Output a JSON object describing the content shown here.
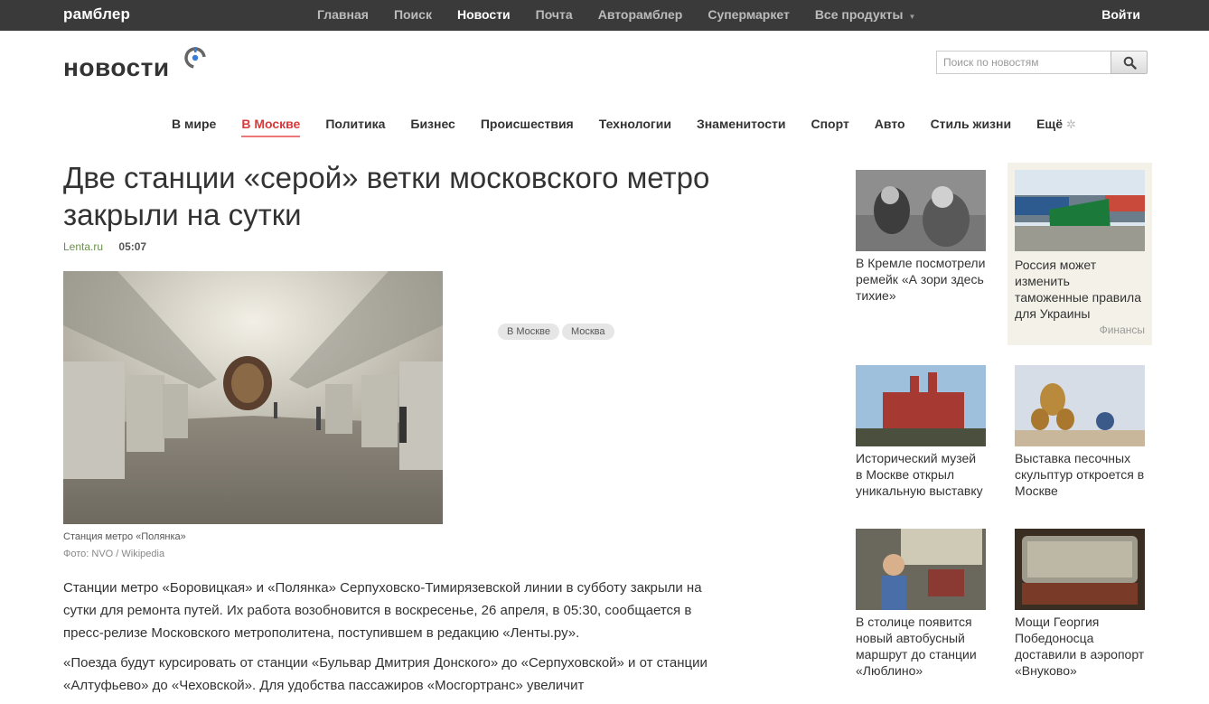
{
  "topbar": {
    "brand": "рамблер",
    "nav": [
      "Главная",
      "Поиск",
      "Новости",
      "Почта",
      "Авторамблер",
      "Супермаркет",
      "Все продукты"
    ],
    "active": "Новости",
    "login": "Войти"
  },
  "logo": {
    "text": "новости"
  },
  "search": {
    "placeholder": "Поиск по новостям"
  },
  "categories": {
    "items": [
      "В мире",
      "В Москве",
      "Политика",
      "Бизнес",
      "Происшествия",
      "Технологии",
      "Знаменитости",
      "Спорт",
      "Авто",
      "Стиль жизни",
      "Ещё"
    ],
    "active": "В Москве"
  },
  "article": {
    "title": "Две станции «серой» ветки московского метро закрыли на сутки",
    "source": "Lenta.ru",
    "time": "05:07",
    "photo_caption": "Станция метро «Полянка»",
    "photo_credit": "Фото: NVO / Wikipedia",
    "tags": [
      "В Москве",
      "Москва"
    ],
    "paragraphs": [
      "Станции метро «Боровицкая» и «Полянка» Серпуховско-Тимирязевской линии в субботу закрыли на сутки для ремонта путей. Их работа возобновится в воскресенье, 26 апреля, в 05:30, сообщается в пресс-релизе Московского метрополитена, поступившем в редакцию «Ленты.ру».",
      "«Поезда будут курсировать от станции «Бульвар Дмитрия Донского» до «Серпуховской» и от станции «Алтуфьево» до «Чеховской». Для удобства пассажиров «Мосгортранс» увеличит"
    ]
  },
  "sidebar": {
    "cards": [
      {
        "text": "В Кремле посмотрели ремейк «А зори здесь тихие»"
      },
      {
        "text": "Россия может изменить таможенные правила для Украины",
        "rubric": "Финансы"
      },
      {
        "text": "Исторический музей в Москве открыл уникальную выставку"
      },
      {
        "text": "Выставка песочных скульптур откроется в Москве"
      },
      {
        "text": "В столице появится новый автобусный маршрут до станции «Люблино»"
      },
      {
        "text": "Мощи Георгия Победоносца доставили в аэропорт «Внуково»"
      }
    ]
  },
  "colors": {
    "topbar": "#3a3a3a",
    "accent": "#d9393a",
    "source": "#6b8e4e",
    "promo_bg": "#f4f2e8"
  }
}
